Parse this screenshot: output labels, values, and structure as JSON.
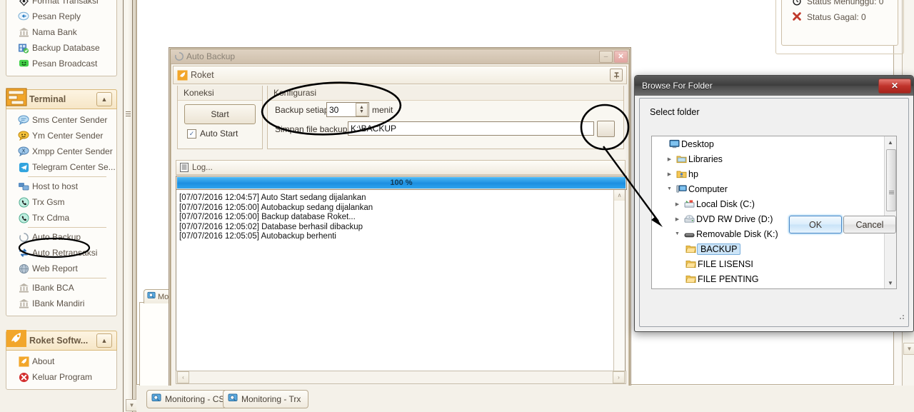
{
  "sidebar": {
    "top_items": [
      {
        "label": "Format Transaksi",
        "icon": "diamond-icon"
      },
      {
        "label": "Pesan Reply",
        "icon": "reply-icon"
      },
      {
        "label": "Nama Bank",
        "icon": "bank-icon"
      },
      {
        "label": "Backup Database",
        "icon": "database-icon"
      },
      {
        "label": "Pesan Broadcast",
        "icon": "broadcast-icon"
      }
    ],
    "terminal_group": {
      "title": "Terminal",
      "icon": "terminal-icon",
      "collapse_icon": "chevron-up-icon",
      "items": [
        {
          "label": "Sms Center Sender",
          "icon": "sms-bubble-icon"
        },
        {
          "label": "Ym Center Sender",
          "icon": "yahoo-bubble-icon"
        },
        {
          "label": "Xmpp Center Sender",
          "icon": "xmpp-bubble-icon"
        },
        {
          "label": "Telegram Center Se...",
          "icon": "telegram-icon"
        },
        {
          "label": "Host to host",
          "icon": "host-icon"
        },
        {
          "label": "Trx Gsm",
          "icon": "phone-gsm-icon"
        },
        {
          "label": "Trx Cdma",
          "icon": "phone-cdma-icon"
        },
        {
          "label": "Auto Backup",
          "icon": "auto-backup-icon"
        },
        {
          "label": "Auto Retransaksi",
          "icon": "retry-arrows-icon"
        },
        {
          "label": "Web Report",
          "icon": "globe-icon"
        },
        {
          "label": "IBank BCA",
          "icon": "bank-icon"
        },
        {
          "label": "IBank Mandiri",
          "icon": "bank-icon"
        }
      ]
    },
    "roket_group": {
      "title": "Roket Softw...",
      "icon": "rocket-icon",
      "collapse_icon": "chevron-up-icon",
      "items": [
        {
          "label": "About",
          "icon": "rocket-icon"
        },
        {
          "label": "Keluar Program",
          "icon": "exit-icon"
        }
      ]
    }
  },
  "status_panel": {
    "rows": [
      {
        "label": "Status Menunggu: 0",
        "icon": "clock-icon"
      },
      {
        "label": "Status Gagal: 0",
        "icon": "red-x-icon"
      }
    ],
    "collapse_icon": "chevron-up-icon"
  },
  "auto_backup": {
    "window_title": "Auto Backup",
    "window_icon": "refresh-circle-icon",
    "minimize_label": "–",
    "close_label": "✕",
    "header_label": "Roket",
    "header_icon": "rocket-icon",
    "pin_icon": "pin-icon",
    "koneksi": {
      "title": "Koneksi",
      "start_button": "Start",
      "auto_start_label": "Auto Start",
      "auto_start_checked": true,
      "check_glyph": "✓"
    },
    "konfigurasi": {
      "title": "Konfigurasi",
      "backup_interval_label": "Backup setiap",
      "backup_interval_value": "30",
      "backup_interval_unit": "menit",
      "save_path_label": "Simpan file backup di",
      "save_path_value": "K:\\BACKUP",
      "browse_button_icon": "browse-ellipsis-icon"
    },
    "log": {
      "header_label": "Log...",
      "header_icon": "log-lines-icon",
      "progress_text": "100 %",
      "progress_percent": 100,
      "entries": [
        "[07/07/2016 12:04:57] Auto Start sedang dijalankan",
        "[07/07/2016 12:05:00] Autobackup sedang dijalankan",
        "[07/07/2016 12:05:00] Backup database Roket...",
        "[07/07/2016 12:05:02] Database berhasil dibackup",
        "[07/07/2016 12:05:05] Autobackup berhenti"
      ],
      "scroll_up_glyph": "∧",
      "scroll_down_glyph": "∨",
      "scroll_left_glyph": "‹",
      "scroll_right_glyph": "›"
    }
  },
  "mini_tab": {
    "label": "Mon",
    "icon": "monitor-icon"
  },
  "bottom_tabs": [
    {
      "label": "Monitoring - CS",
      "icon": "monitor-icon"
    },
    {
      "label": "Monitoring - Trx",
      "icon": "monitor-icon"
    }
  ],
  "browse_dialog": {
    "title": "Browse For Folder",
    "close_label": "✕",
    "prompt": "Select folder",
    "tree": [
      {
        "label": "Desktop",
        "icon": "desktop-icon",
        "indent": 0,
        "expander": "",
        "selected": false
      },
      {
        "label": "Libraries",
        "icon": "libraries-icon",
        "indent": 1,
        "expander": "collapsed",
        "selected": false
      },
      {
        "label": "hp",
        "icon": "user-folder-icon",
        "indent": 1,
        "expander": "collapsed",
        "selected": false
      },
      {
        "label": "Computer",
        "icon": "computer-icon",
        "indent": 1,
        "expander": "expanded",
        "selected": false
      },
      {
        "label": "Local Disk (C:)",
        "icon": "harddisk-icon",
        "indent": 2,
        "expander": "collapsed",
        "selected": false
      },
      {
        "label": "DVD RW Drive (D:)",
        "icon": "dvd-drive-icon",
        "indent": 2,
        "expander": "collapsed",
        "selected": false
      },
      {
        "label": "Removable Disk (K:)",
        "icon": "removable-drive-icon",
        "indent": 2,
        "expander": "expanded",
        "selected": false
      },
      {
        "label": "BACKUP",
        "icon": "folder-icon",
        "indent": 3,
        "expander": "",
        "selected": true
      },
      {
        "label": "FILE LISENSI",
        "icon": "folder-icon",
        "indent": 3,
        "expander": "",
        "selected": false
      },
      {
        "label": "FILE PENTING",
        "icon": "folder-icon",
        "indent": 3,
        "expander": "",
        "selected": false
      }
    ],
    "ok_label": "OK",
    "cancel_label": "Cancel",
    "scroll_up_glyph": "▲",
    "scroll_down_glyph": "▼"
  },
  "colors": {
    "accent_orange": "#f0a21e",
    "progress_blue": "#1c8fe0",
    "selection_blue": "#cce4f7",
    "dialog_close_red": "#c0332b",
    "panel_cream": "#f4f1e9"
  }
}
